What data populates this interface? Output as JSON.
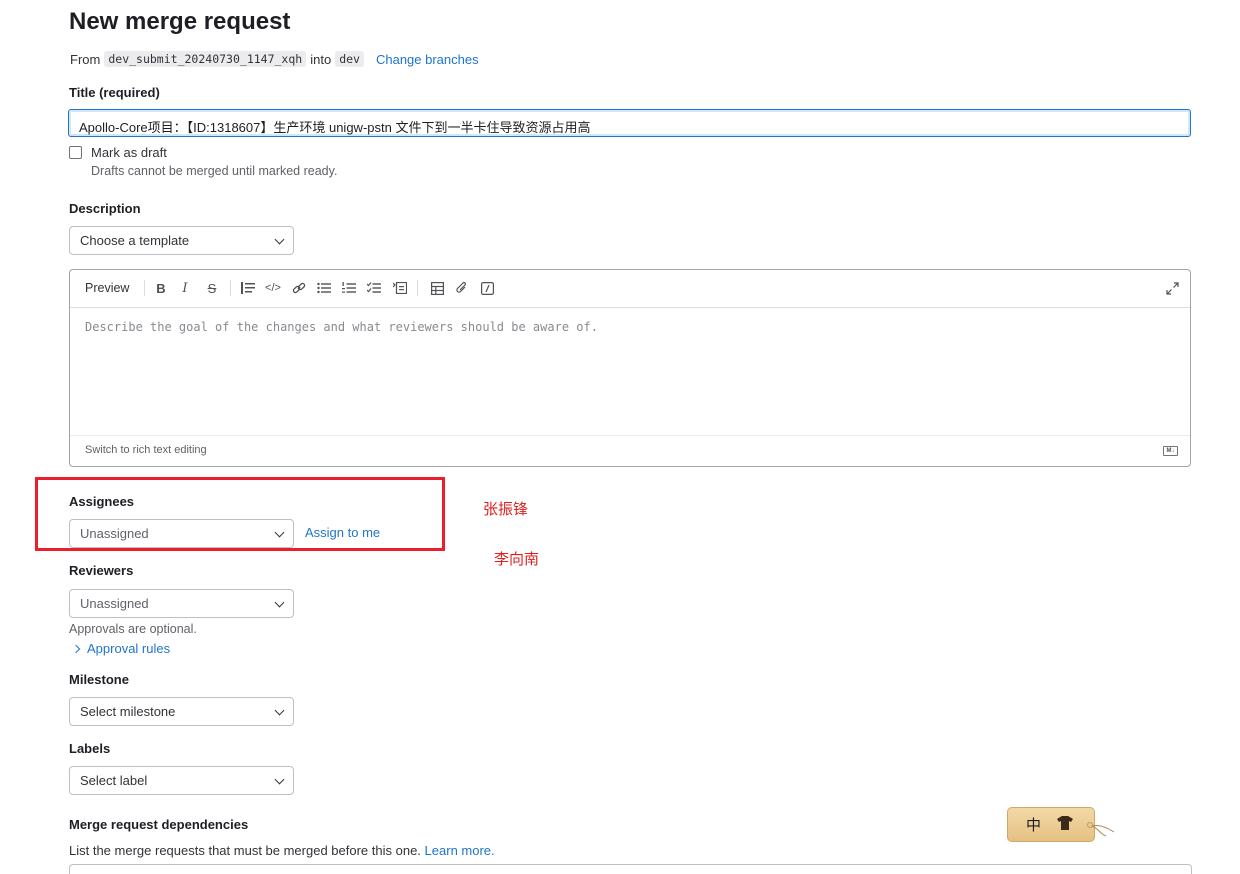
{
  "page": {
    "title": "New merge request",
    "from_label": "From",
    "source_branch": "dev_submit_20240730_1147_xqh",
    "into_label": "into",
    "target_branch": "dev",
    "change_branches": "Change branches"
  },
  "title_field": {
    "label": "Title (required)",
    "value": "Apollo-Core项目：【ID:1318607】生产环境 unigw-pstn 文件下到一半卡住导致资源占用高"
  },
  "draft": {
    "label": "Mark as draft",
    "help": "Drafts cannot be merged until marked ready.",
    "checked": false
  },
  "description": {
    "label": "Description",
    "template_select": "Choose a template",
    "toolbar": {
      "preview": "Preview",
      "icons": [
        "bold-icon",
        "italic-icon",
        "strikethrough-icon",
        "quote-icon",
        "code-icon",
        "link-icon",
        "bullet-list-icon",
        "numbered-list-icon",
        "task-list-icon",
        "collapsible-section-icon",
        "table-icon",
        "attach-file-icon",
        "quick-actions-icon",
        "fullscreen-icon"
      ]
    },
    "placeholder": "Describe the goal of the changes and what reviewers should be aware of.",
    "switch_rich_text": "Switch to rich text editing",
    "markdown_badge": "M↓"
  },
  "assignees": {
    "label": "Assignees",
    "value": "Unassigned",
    "assign_to_me": "Assign to me"
  },
  "reviewers": {
    "label": "Reviewers",
    "value": "Unassigned",
    "help": "Approvals are optional.",
    "approval_rules": "Approval rules"
  },
  "milestone": {
    "label": "Milestone",
    "value": "Select milestone"
  },
  "labels": {
    "label": "Labels",
    "value": "Select label"
  },
  "dependencies": {
    "label": "Merge request dependencies",
    "help": "List the merge requests that must be merged before this one.",
    "learn_more": "Learn more."
  },
  "annotations": {
    "name_1": "张振锋",
    "name_2": "李向南",
    "highlight_color": "#e8202e"
  },
  "ime_tag": {
    "char": "中",
    "icon": "shirt-icon"
  }
}
